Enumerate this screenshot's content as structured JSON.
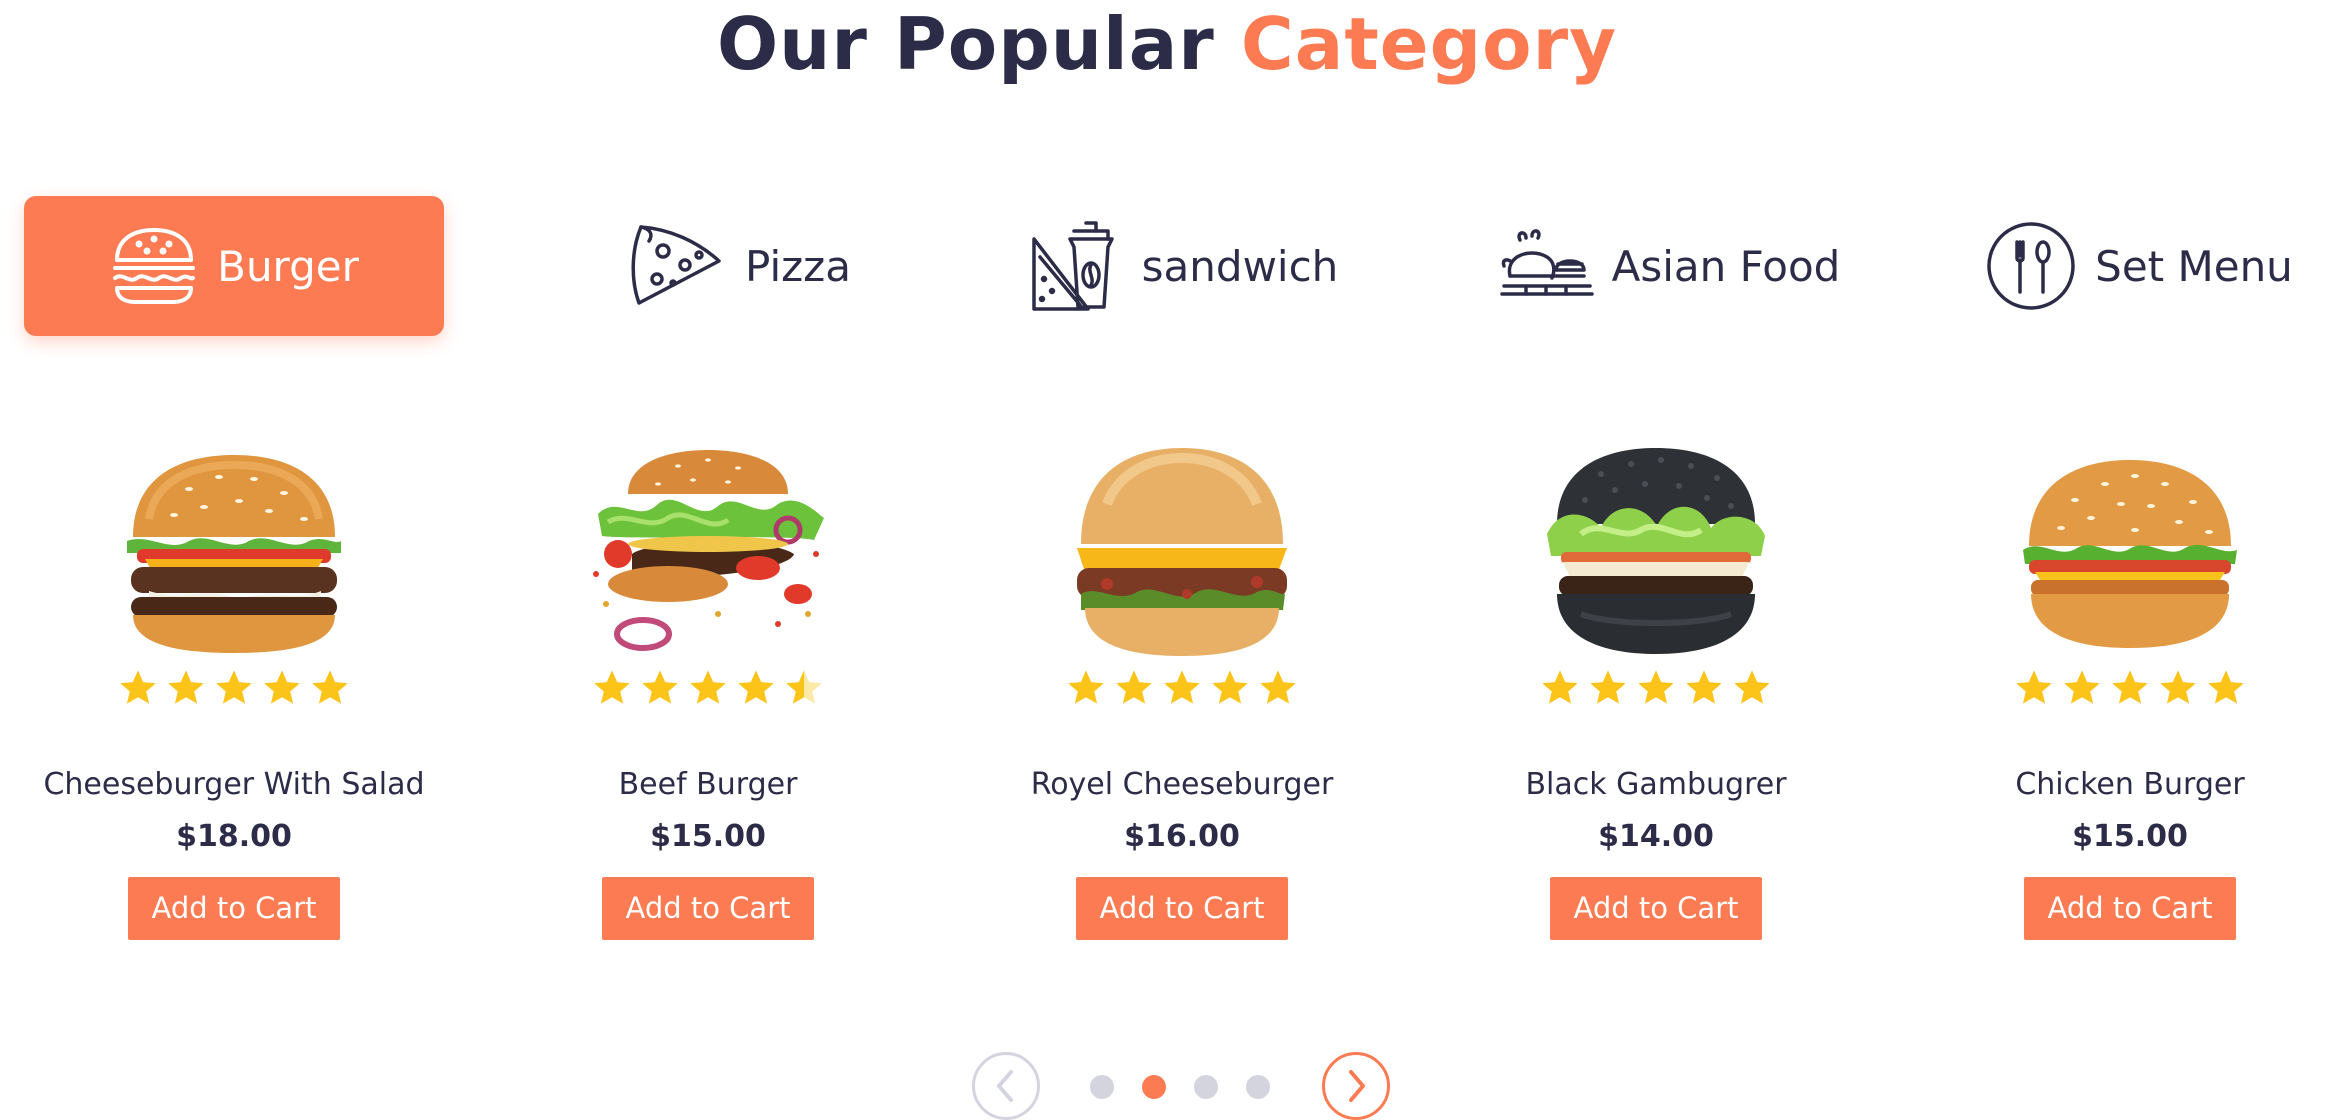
{
  "title": {
    "main": "Our Popular ",
    "accent": "Category"
  },
  "colors": {
    "accent": "#fc7b52",
    "text": "#2c2c48",
    "star": "#fcc419",
    "dot_inactive": "#d4d4de"
  },
  "tabs": [
    {
      "label": "Burger",
      "icon": "burger-icon",
      "active": true
    },
    {
      "label": "Pizza",
      "icon": "pizza-icon",
      "active": false
    },
    {
      "label": "sandwich",
      "icon": "sandwich-coffee-icon",
      "active": false
    },
    {
      "label": "Asian Food",
      "icon": "roast-chicken-icon",
      "active": false
    },
    {
      "label": "Set Menu",
      "icon": "fork-spoon-plate-icon",
      "active": false
    }
  ],
  "products": [
    {
      "name": "Cheeseburger With Salad",
      "price": "$18.00",
      "rating": 5,
      "button": "Add to Cart",
      "image": "cheeseburger-image"
    },
    {
      "name": "Beef Burger",
      "price": "$15.00",
      "rating": 4.5,
      "button": "Add to Cart",
      "image": "beef-burger-image"
    },
    {
      "name": "Royel Cheeseburger",
      "price": "$16.00",
      "rating": 5,
      "button": "Add to Cart",
      "image": "royal-cheeseburger-image"
    },
    {
      "name": "Black Gambugrer",
      "price": "$14.00",
      "rating": 5,
      "button": "Add to Cart",
      "image": "black-burger-image"
    },
    {
      "name": "Chicken Burger",
      "price": "$15.00",
      "rating": 5,
      "button": "Add to Cart",
      "image": "chicken-burger-image"
    }
  ],
  "pager": {
    "prev_icon": "chevron-left-icon",
    "next_icon": "chevron-right-icon",
    "page_count": 4,
    "active_page": 2
  }
}
